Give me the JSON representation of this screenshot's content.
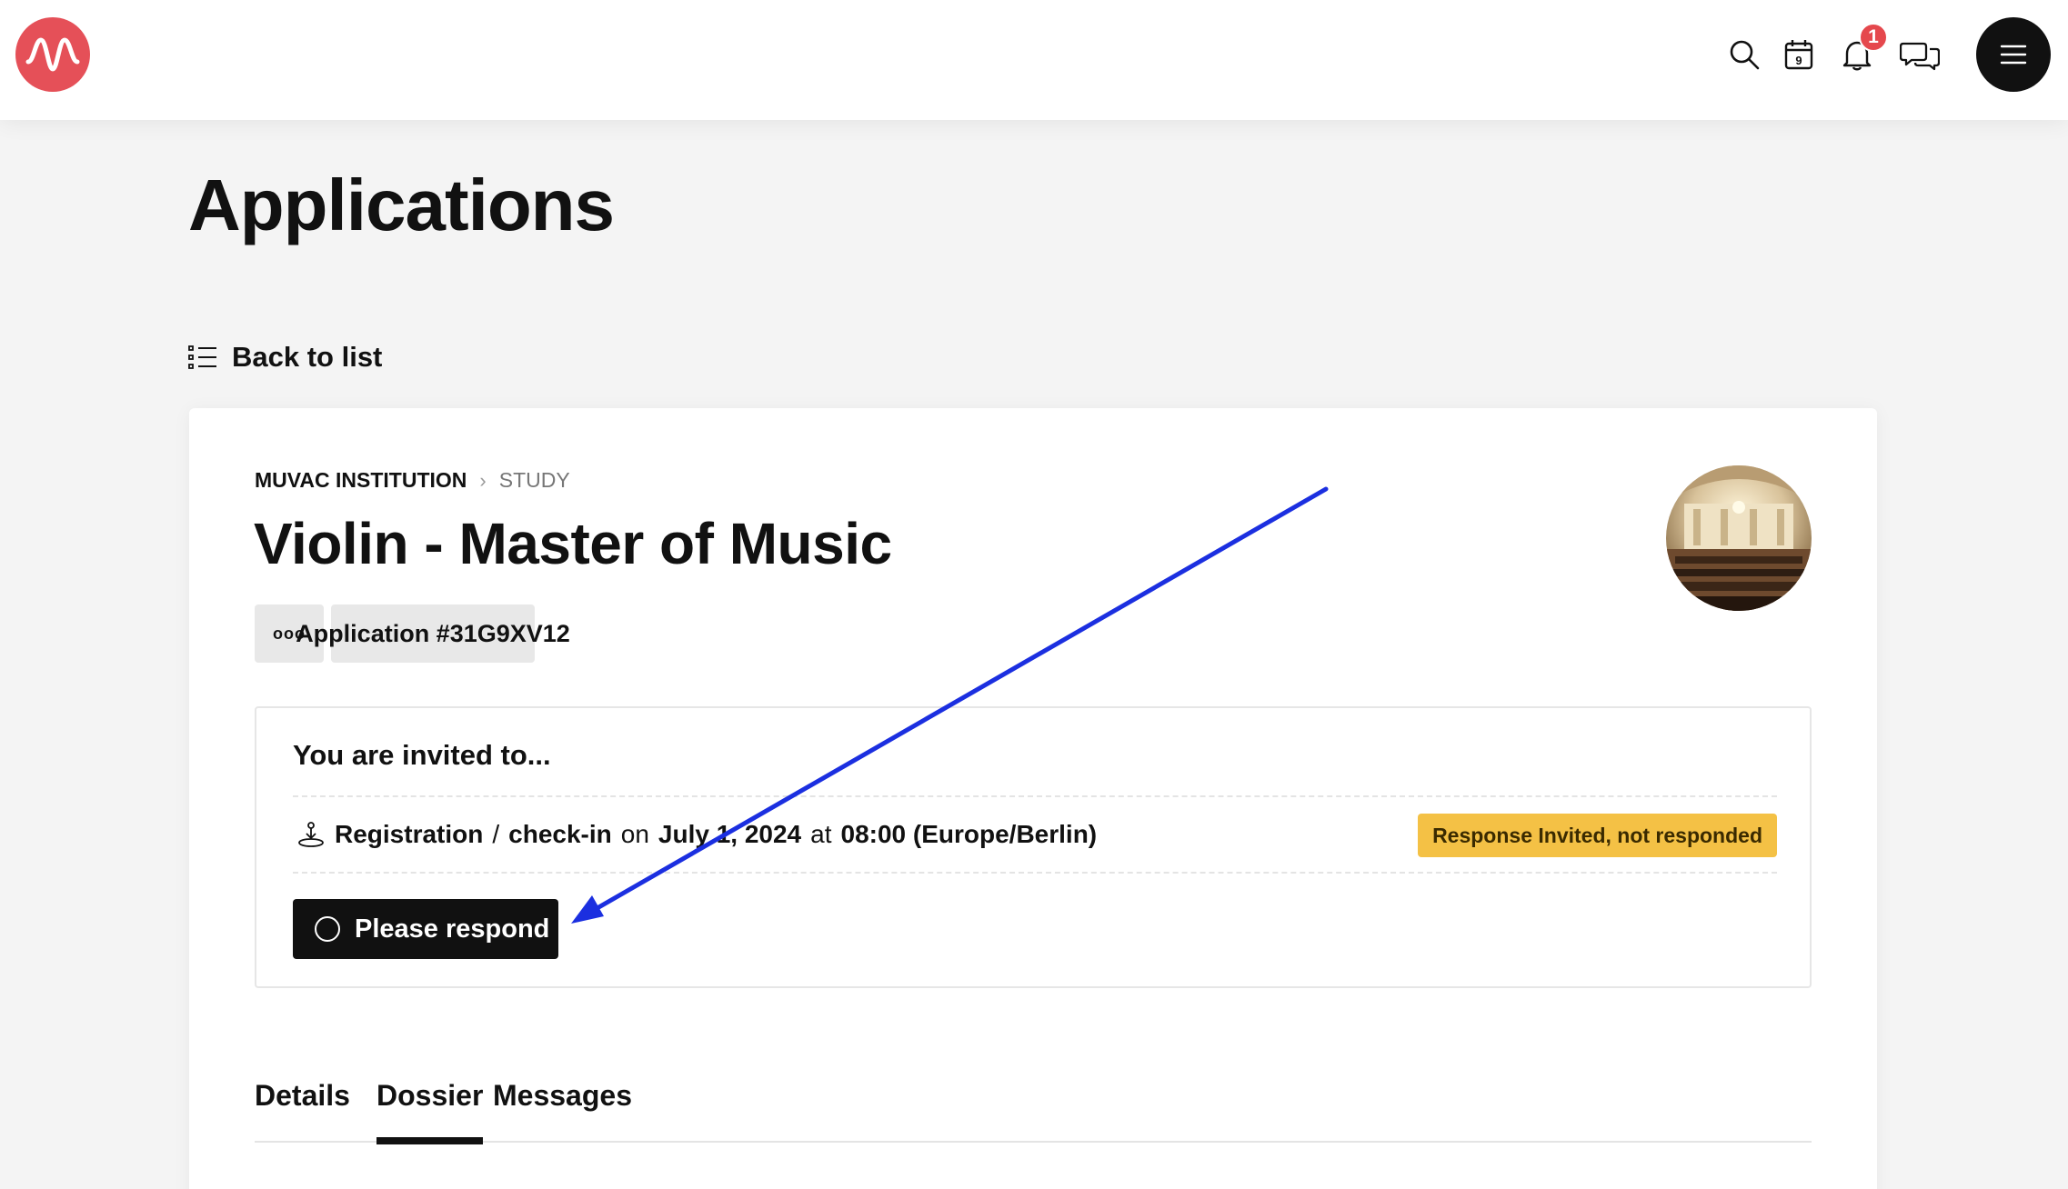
{
  "header": {
    "logo": "muvac-wave-logo",
    "icons": [
      "search-icon",
      "calendar-icon",
      "bell-icon",
      "chat-icon",
      "menu-icon"
    ],
    "calendar_day": "9",
    "notification_count": "1"
  },
  "page": {
    "title": "Applications",
    "back_label": "Back to list"
  },
  "application": {
    "breadcrumb": [
      "MUVAC INSTITUTION",
      "STUDY"
    ],
    "title": "Violin - Master of Music",
    "more_label": "ooo",
    "id_label": "Application #31G9XV12"
  },
  "invitation": {
    "heading": "You are invited to...",
    "event_part1": "Registration",
    "event_sep": "/",
    "event_part2": "check-in",
    "on_word": "on",
    "date": "July 1, 2024",
    "at_word": "at",
    "time": "08:00 (Europe/Berlin)",
    "status": "Response Invited, not responded",
    "respond_label": "Please respond"
  },
  "tabs": [
    {
      "label": "Details",
      "active": false
    },
    {
      "label": "Dossier",
      "active": true
    },
    {
      "label": "Messages",
      "active": false
    }
  ],
  "colors": {
    "brand": "#e55058",
    "status_badge": "#f4c145",
    "annotation_arrow": "#1b2fe0"
  }
}
